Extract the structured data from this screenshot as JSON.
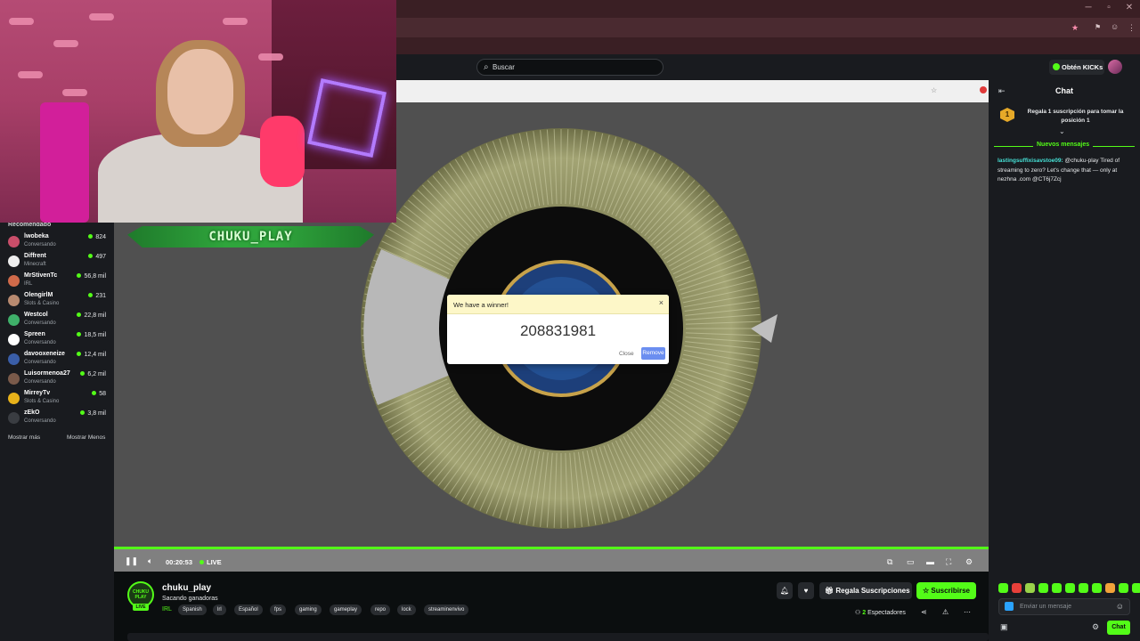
{
  "search": {
    "placeholder": "Buscar"
  },
  "topnav": {
    "kicks_label": "Obtén KICKs"
  },
  "sidebar": {
    "title": "Recomendado",
    "items": [
      {
        "name": "lwobeka",
        "category": "Conversando",
        "viewers": "824",
        "color": "#c94e6a"
      },
      {
        "name": "Diffrent",
        "category": "Minecraft",
        "viewers": "497",
        "color": "#eeeeee"
      },
      {
        "name": "MrStivenTc",
        "category": "IRL",
        "viewers": "56,8 mil",
        "color": "#d06a4a"
      },
      {
        "name": "OlengirlM",
        "category": "Slots & Casino",
        "viewers": "231",
        "color": "#b88a70"
      },
      {
        "name": "Westcol",
        "category": "Conversando",
        "viewers": "22,8 mil",
        "color": "#3fb06a"
      },
      {
        "name": "Spreen",
        "category": "Conversando",
        "viewers": "18,5 mil",
        "color": "#ffffff"
      },
      {
        "name": "davooxeneize",
        "category": "Conversando",
        "viewers": "12,4 mil",
        "color": "#3a5ea8"
      },
      {
        "name": "Luisormenoa27",
        "category": "Conversando",
        "viewers": "6,2 mil",
        "color": "#7a5a4a"
      },
      {
        "name": "MirreyTv",
        "category": "Slots & Casino",
        "viewers": "58",
        "color": "#e8b21a"
      },
      {
        "name": "zEkO",
        "category": "Conversando",
        "viewers": "3,8 mil",
        "color": "#3a3d42"
      }
    ],
    "show_more": "Mostrar más",
    "show_less": "Mostrar Menos"
  },
  "player": {
    "timecode": "00:20:53",
    "live_label": "LIVE",
    "overlay_name": "CHUKU_PLAY"
  },
  "dialog": {
    "title": "We have a winner!",
    "winner": "208831981",
    "close_label": "Close",
    "remove_label": "Remove"
  },
  "chat": {
    "title": "Chat",
    "gift_rank": "1",
    "gift_text": "Regala 1 suscripción para tomar la posición 1",
    "new_messages": "Nuevos mensajes",
    "message": {
      "user": "lastingsuffixisavstoe09:",
      "text": " @chuku-play Tired of streaming to zero? Let's change that — only at nezhna .com @CT6j7Zcj"
    },
    "input_placeholder": "Enviar un mensaje",
    "send_label": "Chat"
  },
  "channel": {
    "avatar_text": "CHUKU PLAY",
    "live_badge": "LIVE",
    "name": "chuku_play",
    "stream_title": "Sacando ganadoras",
    "category": "IRL",
    "tags": [
      "Spanish",
      "lrl",
      "Español",
      "fps",
      "gaming",
      "gameplay",
      "repo",
      "lock",
      "streaminenvivo"
    ],
    "gift_button": "Regala Suscripciones",
    "subscribe_button": "Suscribirse",
    "viewers_count": "2",
    "viewers_label": " Espectadores"
  },
  "colors": {
    "accent": "#53fc18",
    "background": "#0b0e0f",
    "panel": "#191b1f"
  }
}
